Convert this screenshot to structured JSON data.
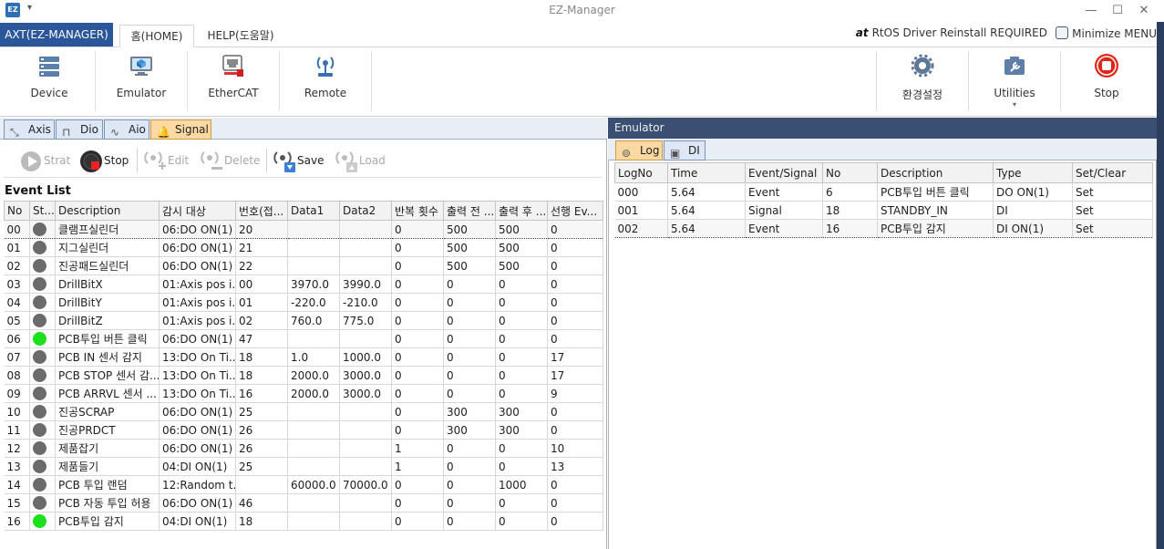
{
  "window": {
    "title": "EZ-Manager",
    "app_icon": "EZ"
  },
  "ribbon_tabs": {
    "app_menu": "AXT(EZ-MANAGER)",
    "home": "홈(HOME)",
    "help": "HELP(도움말)"
  },
  "status": {
    "rtos_logo": "at",
    "rtos_text": "RtOS Driver Reinstall REQUIRED",
    "minimize_menu": "Minimize MENU"
  },
  "ribbon": {
    "device": "Device",
    "emulator": "Emulator",
    "ethercat": "EtherCAT",
    "remote": "Remote",
    "settings": "환경설정",
    "utilities": "Utilities",
    "stop": "Stop"
  },
  "left_tabs": [
    "Axis",
    "Dio",
    "Aio",
    "Signal"
  ],
  "toolbar": {
    "strat": "Strat",
    "stop": "Stop",
    "edit": "Edit",
    "delete": "Delete",
    "save": "Save",
    "load": "Load"
  },
  "event_list": {
    "title": "Event List",
    "columns": [
      "No",
      "St...",
      "Description",
      "감시 대상",
      "번호(접...",
      "Data1",
      "Data2",
      "반복 횟수",
      "출력 전 ...",
      "출력 후 ...",
      "선행 Ev..."
    ],
    "rows": [
      {
        "no": "00",
        "on": false,
        "desc": "클램프실린더",
        "target": "06:DO ON(1)",
        "num": "20",
        "d1": "",
        "d2": "",
        "rep": "0",
        "pre": "500",
        "post": "500",
        "prev": "0"
      },
      {
        "no": "01",
        "on": false,
        "desc": "지그실린더",
        "target": "06:DO ON(1)",
        "num": "21",
        "d1": "",
        "d2": "",
        "rep": "0",
        "pre": "500",
        "post": "500",
        "prev": "0"
      },
      {
        "no": "02",
        "on": false,
        "desc": "진공패드실린더",
        "target": "06:DO ON(1)",
        "num": "22",
        "d1": "",
        "d2": "",
        "rep": "0",
        "pre": "500",
        "post": "500",
        "prev": "0"
      },
      {
        "no": "03",
        "on": false,
        "desc": "DrillBitX",
        "target": "01:Axis pos i...",
        "num": "00",
        "d1": "3970.0",
        "d2": "3990.0",
        "rep": "0",
        "pre": "0",
        "post": "0",
        "prev": "0"
      },
      {
        "no": "04",
        "on": false,
        "desc": "DrillBitY",
        "target": "01:Axis pos i...",
        "num": "01",
        "d1": "-220.0",
        "d2": "-210.0",
        "rep": "0",
        "pre": "0",
        "post": "0",
        "prev": "0"
      },
      {
        "no": "05",
        "on": false,
        "desc": "DrillBitZ",
        "target": "01:Axis pos i...",
        "num": "02",
        "d1": "760.0",
        "d2": "775.0",
        "rep": "0",
        "pre": "0",
        "post": "0",
        "prev": "0"
      },
      {
        "no": "06",
        "on": true,
        "desc": "PCB투입 버튼 클릭",
        "target": "06:DO ON(1)",
        "num": "47",
        "d1": "",
        "d2": "",
        "rep": "0",
        "pre": "0",
        "post": "0",
        "prev": "0"
      },
      {
        "no": "07",
        "on": false,
        "desc": "PCB IN 센서 감지",
        "target": "13:DO On Ti...",
        "num": "18",
        "d1": "1.0",
        "d2": "1000.0",
        "rep": "0",
        "pre": "0",
        "post": "0",
        "prev": "17"
      },
      {
        "no": "08",
        "on": false,
        "desc": "PCB STOP 센서 감...",
        "target": "13:DO On Ti...",
        "num": "18",
        "d1": "2000.0",
        "d2": "3000.0",
        "rep": "0",
        "pre": "0",
        "post": "0",
        "prev": "17"
      },
      {
        "no": "09",
        "on": false,
        "desc": "PCB ARRVL 센서 ...",
        "target": "13:DO On Ti...",
        "num": "16",
        "d1": "2000.0",
        "d2": "3000.0",
        "rep": "0",
        "pre": "0",
        "post": "0",
        "prev": "9"
      },
      {
        "no": "10",
        "on": false,
        "desc": "진공SCRAP",
        "target": "06:DO ON(1)",
        "num": "25",
        "d1": "",
        "d2": "",
        "rep": "0",
        "pre": "300",
        "post": "300",
        "prev": "0"
      },
      {
        "no": "11",
        "on": false,
        "desc": "진공PRDCT",
        "target": "06:DO ON(1)",
        "num": "26",
        "d1": "",
        "d2": "",
        "rep": "0",
        "pre": "300",
        "post": "300",
        "prev": "0"
      },
      {
        "no": "12",
        "on": false,
        "desc": "제품잡기",
        "target": "06:DO ON(1)",
        "num": "26",
        "d1": "",
        "d2": "",
        "rep": "1",
        "pre": "0",
        "post": "0",
        "prev": "10"
      },
      {
        "no": "13",
        "on": false,
        "desc": "제품들기",
        "target": "04:DI ON(1)",
        "num": "25",
        "d1": "",
        "d2": "",
        "rep": "1",
        "pre": "0",
        "post": "0",
        "prev": "13"
      },
      {
        "no": "14",
        "on": false,
        "desc": "PCB 투입 랜덤",
        "target": "12:Random t...",
        "num": "",
        "d1": "60000.0",
        "d2": "70000.0",
        "rep": "0",
        "pre": "0",
        "post": "1000",
        "prev": "0"
      },
      {
        "no": "15",
        "on": false,
        "desc": "PCB 자동 투입 허용",
        "target": "06:DO ON(1)",
        "num": "46",
        "d1": "",
        "d2": "",
        "rep": "0",
        "pre": "0",
        "post": "0",
        "prev": "0"
      },
      {
        "no": "16",
        "on": true,
        "desc": "PCB투입 감지",
        "target": "04:DI ON(1)",
        "num": "18",
        "d1": "",
        "d2": "",
        "rep": "0",
        "pre": "0",
        "post": "0",
        "prev": "0"
      }
    ]
  },
  "emulator": {
    "header": "Emulator",
    "tabs": [
      "Log",
      "DI"
    ],
    "columns": [
      "LogNo",
      "Time",
      "Event/Signal",
      "No",
      "Description",
      "Type",
      "Set/Clear"
    ],
    "rows": [
      {
        "logno": "000",
        "time": "5.64",
        "es": "Event",
        "no": "6",
        "desc": "PCB투입 버튼 클릭",
        "type": "DO ON(1)",
        "sc": "Set"
      },
      {
        "logno": "001",
        "time": "5.64",
        "es": "Signal",
        "no": "18",
        "desc": "STANDBY_IN",
        "type": "DI",
        "sc": "Set"
      },
      {
        "logno": "002",
        "time": "5.64",
        "es": "Event",
        "no": "16",
        "desc": "PCB투입 감지",
        "type": "DI ON(1)",
        "sc": "Set"
      }
    ]
  }
}
